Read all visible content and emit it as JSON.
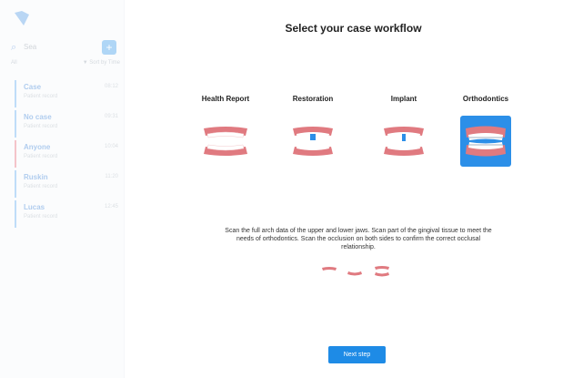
{
  "sidebar": {
    "search_placeholder": "Sea",
    "add_icon": "plus-icon",
    "filter_left": "All",
    "filter_right": "▼ Sort by Time",
    "cases": [
      {
        "name": "Case",
        "time": "08:12",
        "sub": "Patient record"
      },
      {
        "name": "No case",
        "time": "09:31",
        "sub": "Patient record"
      },
      {
        "name": "Anyone",
        "time": "10:04",
        "sub": "Patient record"
      },
      {
        "name": "Ruskin",
        "time": "11:20",
        "sub": "Patient record"
      },
      {
        "name": "Lucas",
        "time": "12:45",
        "sub": "Patient record"
      }
    ]
  },
  "main": {
    "title": "Select your case workflow",
    "workflows": [
      {
        "label": "Health Report",
        "selected": false,
        "icon": "jaws-icon"
      },
      {
        "label": "Restoration",
        "selected": false,
        "icon": "restoration-icon"
      },
      {
        "label": "Implant",
        "selected": false,
        "icon": "implant-icon"
      },
      {
        "label": "Orthodontics",
        "selected": true,
        "icon": "braces-icon"
      }
    ],
    "description": "Scan the full arch data of the upper and lower jaws. Scan part of the gingival tissue to meet the needs of orthodontics. Scan the occlusion on both sides to confirm the correct occlusal relationship.",
    "next_button": "Next step"
  },
  "colors": {
    "accent": "#1e8be6",
    "selected_bg": "#2c8fe8",
    "gum": "#e07a80",
    "tooth": "#ffffff"
  }
}
